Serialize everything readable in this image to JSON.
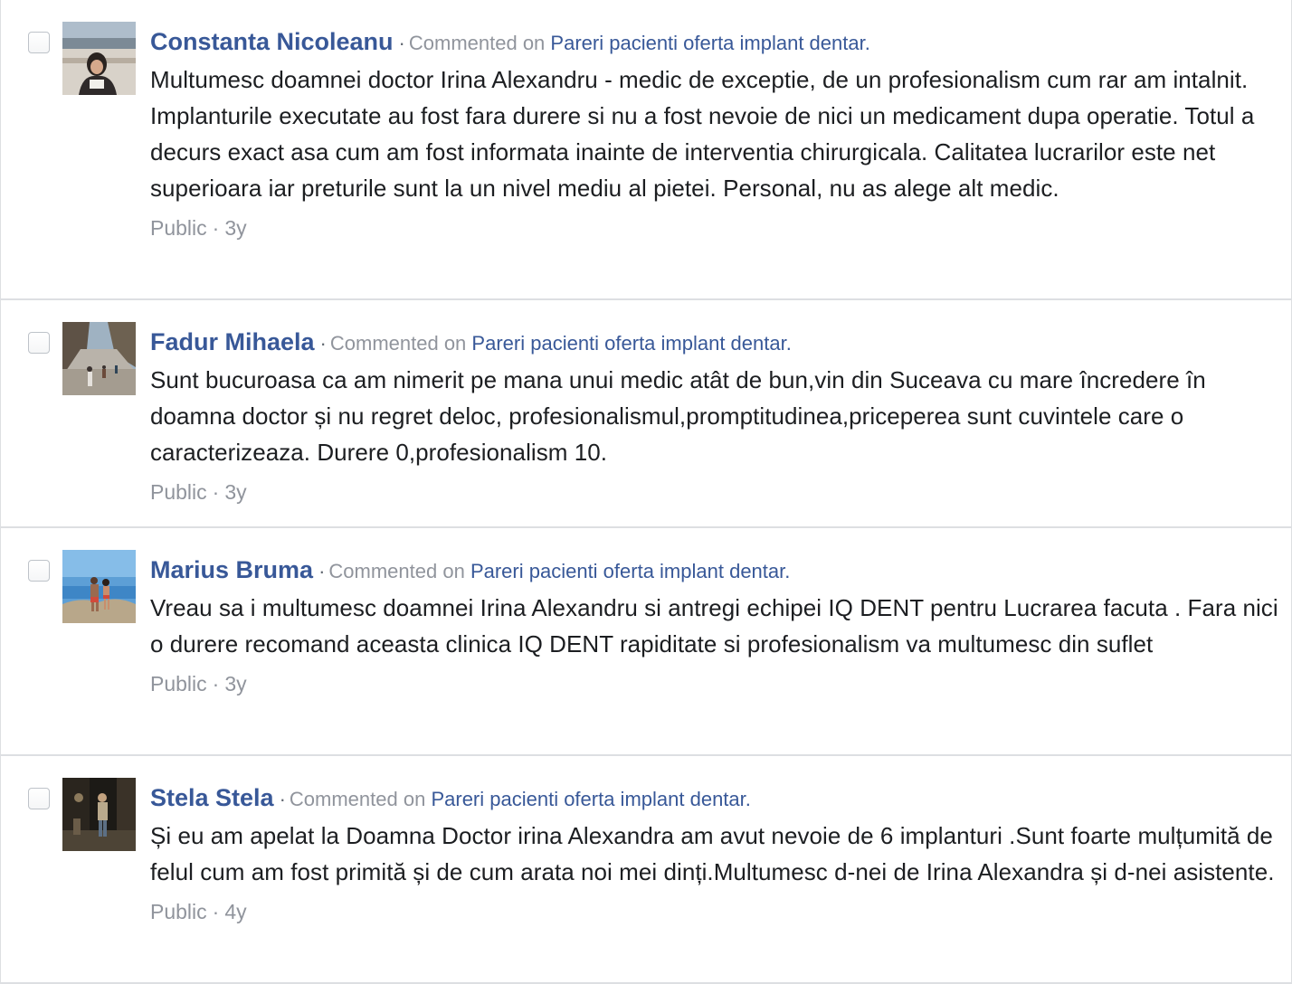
{
  "comments": [
    {
      "author": "Constanta Nicoleanu",
      "separator": "·",
      "commented_on": "Commented on",
      "post_title": "Pareri pacienti oferta implant dentar.",
      "text": "Multumesc doamnei doctor Irina Alexandru - medic de exceptie, de un profesionalism cum rar am intalnit. Implanturile executate au fost fara durere si nu a fost nevoie de nici un medicament dupa operatie. Totul a decurs exact asa cum am fost informata inainte de interventia chirurgicala. Calitatea lucrarilor este net superioara iar preturile sunt la un nivel mediu al pietei. Personal, nu as alege alt medic.",
      "privacy": "Public",
      "dot": "·",
      "age": "3y"
    },
    {
      "author": "Fadur Mihaela",
      "separator": "·",
      "commented_on": "Commented on",
      "post_title": "Pareri pacienti oferta implant dentar.",
      "text": "Sunt bucuroasa ca am nimerit pe mana unui medic atât de bun,vin din Suceava cu mare încredere în doamna doctor și nu regret deloc, profesionalismul,promptitudinea,priceperea sunt cuvintele care o caracterizeaza. Durere 0,profesionalism 10.",
      "privacy": "Public",
      "dot": "·",
      "age": "3y"
    },
    {
      "author": "Marius Bruma",
      "separator": "·",
      "commented_on": "Commented on",
      "post_title": "Pareri pacienti oferta implant dentar.",
      "text": "Vreau sa i multumesc doamnei Irina Alexandru si antregi echipei IQ DENT pentru Lucrarea facuta . Fara nici o durere recomand aceasta clinica IQ DENT rapiditate si profesionalism va multumesc din suflet",
      "privacy": "Public",
      "dot": "·",
      "age": "3y"
    },
    {
      "author": "Stela Stela",
      "separator": "·",
      "commented_on": "Commented on",
      "post_title": "Pareri pacienti oferta implant dentar.",
      "text": "Și eu am apelat la Doamna Doctor irina Alexandra am avut nevoie de 6 implanturi .Sunt foarte mulțumită de felul cum am fost primită și de cum arata noi mei dinți.Multumesc d-nei de Irina Alexandra și d-nei asistente.",
      "privacy": "Public",
      "dot": "·",
      "age": "4y"
    }
  ],
  "colors": {
    "link": "#385898",
    "muted": "#90949c",
    "text": "#1c1e21",
    "divider": "#dddfe2"
  }
}
